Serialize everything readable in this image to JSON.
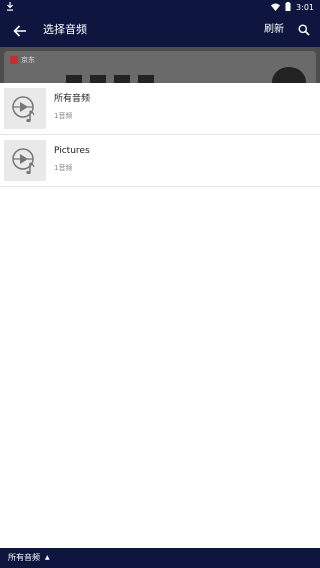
{
  "status_bar": {
    "time": "3:01",
    "icons": [
      "download-icon",
      "wifi-icon",
      "battery-icon"
    ]
  },
  "app_bar": {
    "title": "选择音频",
    "refresh_label": "刷新",
    "icons": [
      "back-arrow-icon",
      "search-icon"
    ]
  },
  "background_content": {
    "brand": "京东"
  },
  "folders": [
    {
      "name": "所有音频",
      "count": "1音频",
      "icon": "audio-file-icon"
    },
    {
      "name": "Pictures",
      "count": "1音频",
      "icon": "audio-file-icon"
    }
  ],
  "bottom_bar": {
    "selected_folder": "所有音频",
    "caret": "▲"
  },
  "colors": {
    "primary": "#0e1640",
    "thumb_bg": "#e9e9e9",
    "secondary_text": "#888888"
  }
}
